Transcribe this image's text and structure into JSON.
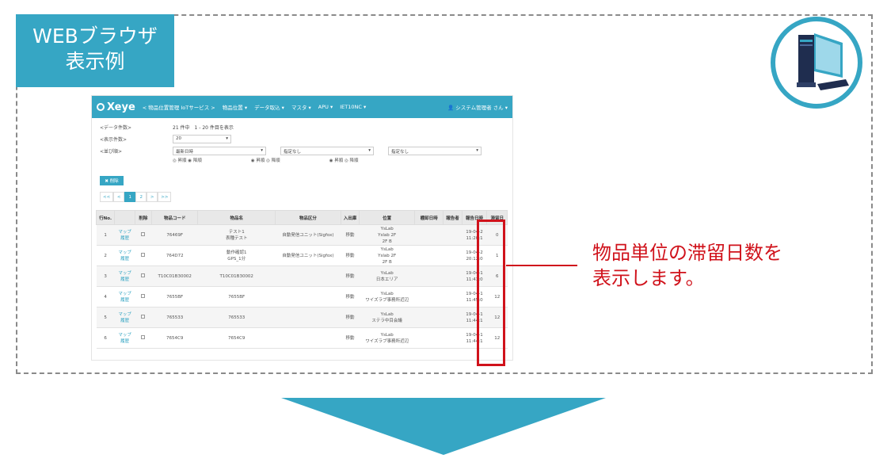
{
  "label": {
    "line1": "WEBブラウザ",
    "line2": "表示例"
  },
  "callout": {
    "line1": "物品単位の滞留日数を",
    "line2": "表示します。"
  },
  "colors": {
    "accent": "#36a6c4",
    "highlight": "#d0121b"
  },
  "app": {
    "logo": "Xeye",
    "nav": [
      "< 物品位置管理 IoTサービス >",
      "物品位置 ▾",
      "データ取込 ▾",
      "マスタ ▾",
      "APU ▾",
      "IET10NC ▾"
    ],
    "user": "👤 システム管理者 さん ▾",
    "count_label": "<データ件数>",
    "count_value": "21 件中　1 - 20 件目を表示",
    "per_page_label": "<表示件数>",
    "per_page_value": "20",
    "sort_label": "<並び順>",
    "sort1": "最新日時",
    "sort2": "指定なし",
    "sort3": "指定なし",
    "radio1": "◎ 昇順  ◉ 降順",
    "radio2": "◉ 昇順  ◎ 降順",
    "radio3": "◉ 昇順  ◎ 降順",
    "delete_button": "✖ 削除",
    "pager": [
      "<<",
      "<",
      "1",
      "2",
      ">",
      ">>"
    ],
    "columns": [
      "行No.",
      "",
      "削除",
      "物品コード",
      "物品名",
      "物品区分",
      "入出庫",
      "位置",
      "棚卸日時",
      "報告者",
      "報告日時",
      "滞留日"
    ],
    "rows": [
      {
        "no": "1",
        "link": "マップ\n履歴",
        "code": "76469F",
        "name": "テスト1\n表種テスト",
        "kind": "自動発信ユニット(Sigfox)",
        "io": "移動",
        "pos": "YsLab\nYslab 2F\n2F B",
        "date": "19-04-2\n11:20:1",
        "days": "0"
      },
      {
        "no": "2",
        "link": "マップ\n履歴",
        "code": "764D72",
        "name": "動作確認1\nGPS_1分",
        "kind": "自動発信ユニット(Sigfox)",
        "io": "移動",
        "pos": "YsLab\nYslab 2F\n2F B",
        "date": "19-04-2\n20:12:0",
        "days": "1"
      },
      {
        "no": "3",
        "link": "マップ\n履歴",
        "code": "T10C01B30002",
        "name": "T10C01B30002",
        "kind": "",
        "io": "移動",
        "pos": "YsLab\n日本エリア",
        "date": "19-04-1\n11:43:0",
        "days": "6"
      },
      {
        "no": "4",
        "link": "マップ\n履歴",
        "code": "7655BF",
        "name": "7655BF",
        "kind": "",
        "io": "移動",
        "pos": "YsLab\nワイズラブ事務所近辺",
        "date": "19-04-1\n11:45:0",
        "days": "12"
      },
      {
        "no": "5",
        "link": "マップ\n履歴",
        "code": "765533",
        "name": "765533",
        "kind": "",
        "io": "移動",
        "pos": "YsLab\nステラ中目会議",
        "date": "19-04-1\n11:44:1",
        "days": "12"
      },
      {
        "no": "6",
        "link": "マップ\n履歴",
        "code": "7654C9",
        "name": "7654C9",
        "kind": "",
        "io": "移動",
        "pos": "YsLab\nワイズラブ事務所近辺",
        "date": "19-04-1\n11:44:1",
        "days": "12"
      }
    ]
  }
}
